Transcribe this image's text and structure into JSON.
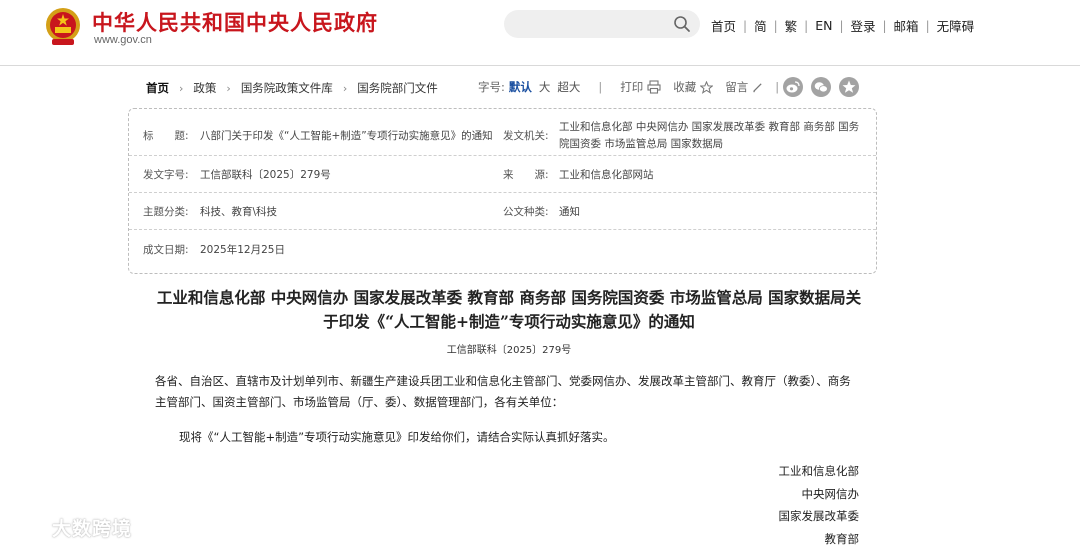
{
  "header": {
    "site_name": "中华人民共和国中央人民政府",
    "site_domain": "www.gov.cn",
    "search": {
      "placeholder": "",
      "value": ""
    },
    "nav": [
      "首页",
      "简",
      "繁",
      "EN",
      "登录",
      "邮箱",
      "无障碍"
    ]
  },
  "breadcrumb": [
    "首页",
    "政策",
    "国务院政策文件库",
    "国务院部门文件"
  ],
  "tools": {
    "font_size_label": "字号:",
    "font_sizes": [
      "默认",
      "大",
      "超大"
    ],
    "print_label": "打印",
    "favorite_label": "收藏",
    "comment_label": "留言"
  },
  "share_icons": [
    "weibo-icon",
    "wechat-icon",
    "more-share-icon"
  ],
  "meta": {
    "title_key": "标　　题:",
    "title_value": "八部门关于印发《“人工智能+制造”专项行动实施意见》的通知",
    "issuer_key": "发文机关:",
    "issuer_value": "工业和信息化部 中央网信办 国家发展改革委 教育部 商务部 国务院国资委 市场监管总局 国家数据局",
    "doc_no_key": "发文字号:",
    "doc_no_value": "工信部联科〔2025〕279号",
    "source_key": "来　　源:",
    "source_value": "工业和信息化部网站",
    "topic_key": "主题分类:",
    "topic_value": "科技、教育\\科技",
    "doc_type_key": "公文种类:",
    "doc_type_value": "通知",
    "date_key": "成文日期:",
    "date_value": "2025年12月25日"
  },
  "document": {
    "title": "工业和信息化部 中央网信办 国家发展改革委 教育部 商务部 国务院国资委 市场监管总局 国家数据局关于印发《“人工智能+制造”专项行动实施意见》的通知",
    "number": "工信部联科〔2025〕279号",
    "addressees": "各省、自治区、直辖市及计划单列市、新疆生产建设兵团工业和信息化主管部门、党委网信办、发展改革主管部门、教育厅（教委）、商务主管部门、国资主管部门、市场监管局（厅、委）、数据管理部门，各有关单位：",
    "body": "现将《“人工智能+制造”专项行动实施意见》印发给你们，请结合实际认真抓好落实。",
    "signers": [
      "工业和信息化部",
      "中央网信办",
      "国家发展改革委",
      "教育部"
    ]
  },
  "watermark": "大数跨境",
  "colors": {
    "brand_red": "#c8161d",
    "active_blue": "#1a4fa0"
  }
}
